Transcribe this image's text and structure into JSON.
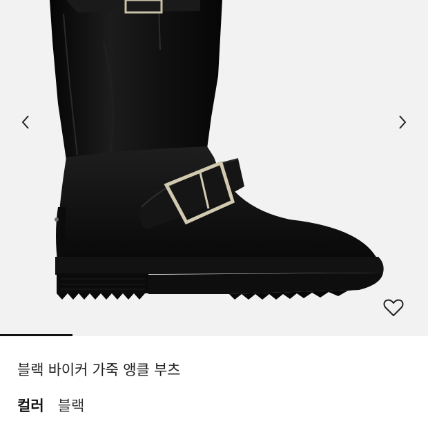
{
  "gallery": {
    "prev_icon": "chevron-left-icon",
    "next_icon": "chevron-right-icon",
    "wishlist_icon": "heart-outline-icon",
    "background": "#f2f2f2",
    "image_alt": "black leather biker boot with silver buckles",
    "slide_progress": 0.17
  },
  "product": {
    "name": "블랙 바이커 가죽 앵클 부츠",
    "color_label": "컬러",
    "color_value": "블랙"
  }
}
